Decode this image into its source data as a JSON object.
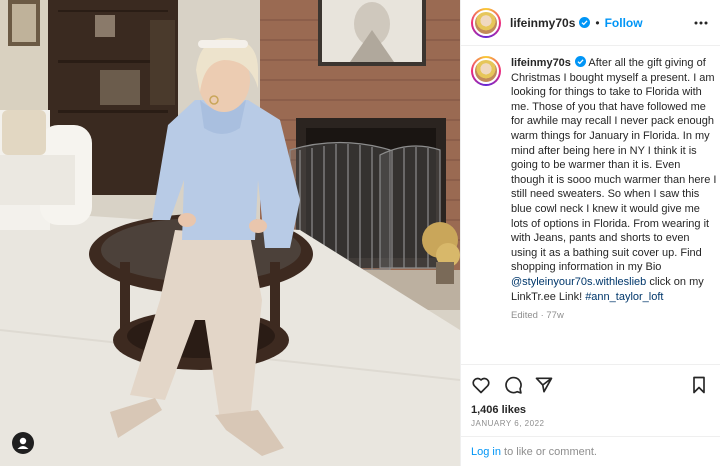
{
  "post": {
    "username": "lifeinmy70s",
    "follow_label": "Follow",
    "separator": "•",
    "caption_username": "lifeinmy70s",
    "caption_text": "After all the gift giving of Christmas I bought myself a present. I am looking for things to take to Florida with me. Those of you that have followed me for awhile may recall I never pack enough warm things for January in Florida. In my mind after being here in NY I think it is going to be warmer than it is. Even though it is sooo much warmer than here I still need sweaters. So when I saw this blue cowl neck I knew it would give me lots of options in Florida. From wearing it with Jeans, pants and shorts to even using it as a bathing suit cover up. Find shopping information in my Bio ",
    "caption_mention": "@styleinyour70s.withleslieb",
    "caption_mid": " click on my LinkTr.ee Link! ",
    "caption_hashtag": "#ann_taylor_loft",
    "edited": "Edited · 77w",
    "likes": "1,406 likes",
    "date": "JANUARY 6, 2022",
    "login_label": "Log in",
    "comment_prompt": " to like or comment."
  },
  "icons": {
    "verified": "verified-badge-icon",
    "more": "more-options-icon",
    "like": "heart-icon",
    "comment": "comment-icon",
    "share": "share-icon",
    "save": "bookmark-icon",
    "user_tag": "user-tag-icon"
  },
  "colors": {
    "accent": "#0095f6",
    "link": "#00376b",
    "muted": "#8e8e8e",
    "text": "#262626",
    "sweater": "#b8cbe6"
  }
}
